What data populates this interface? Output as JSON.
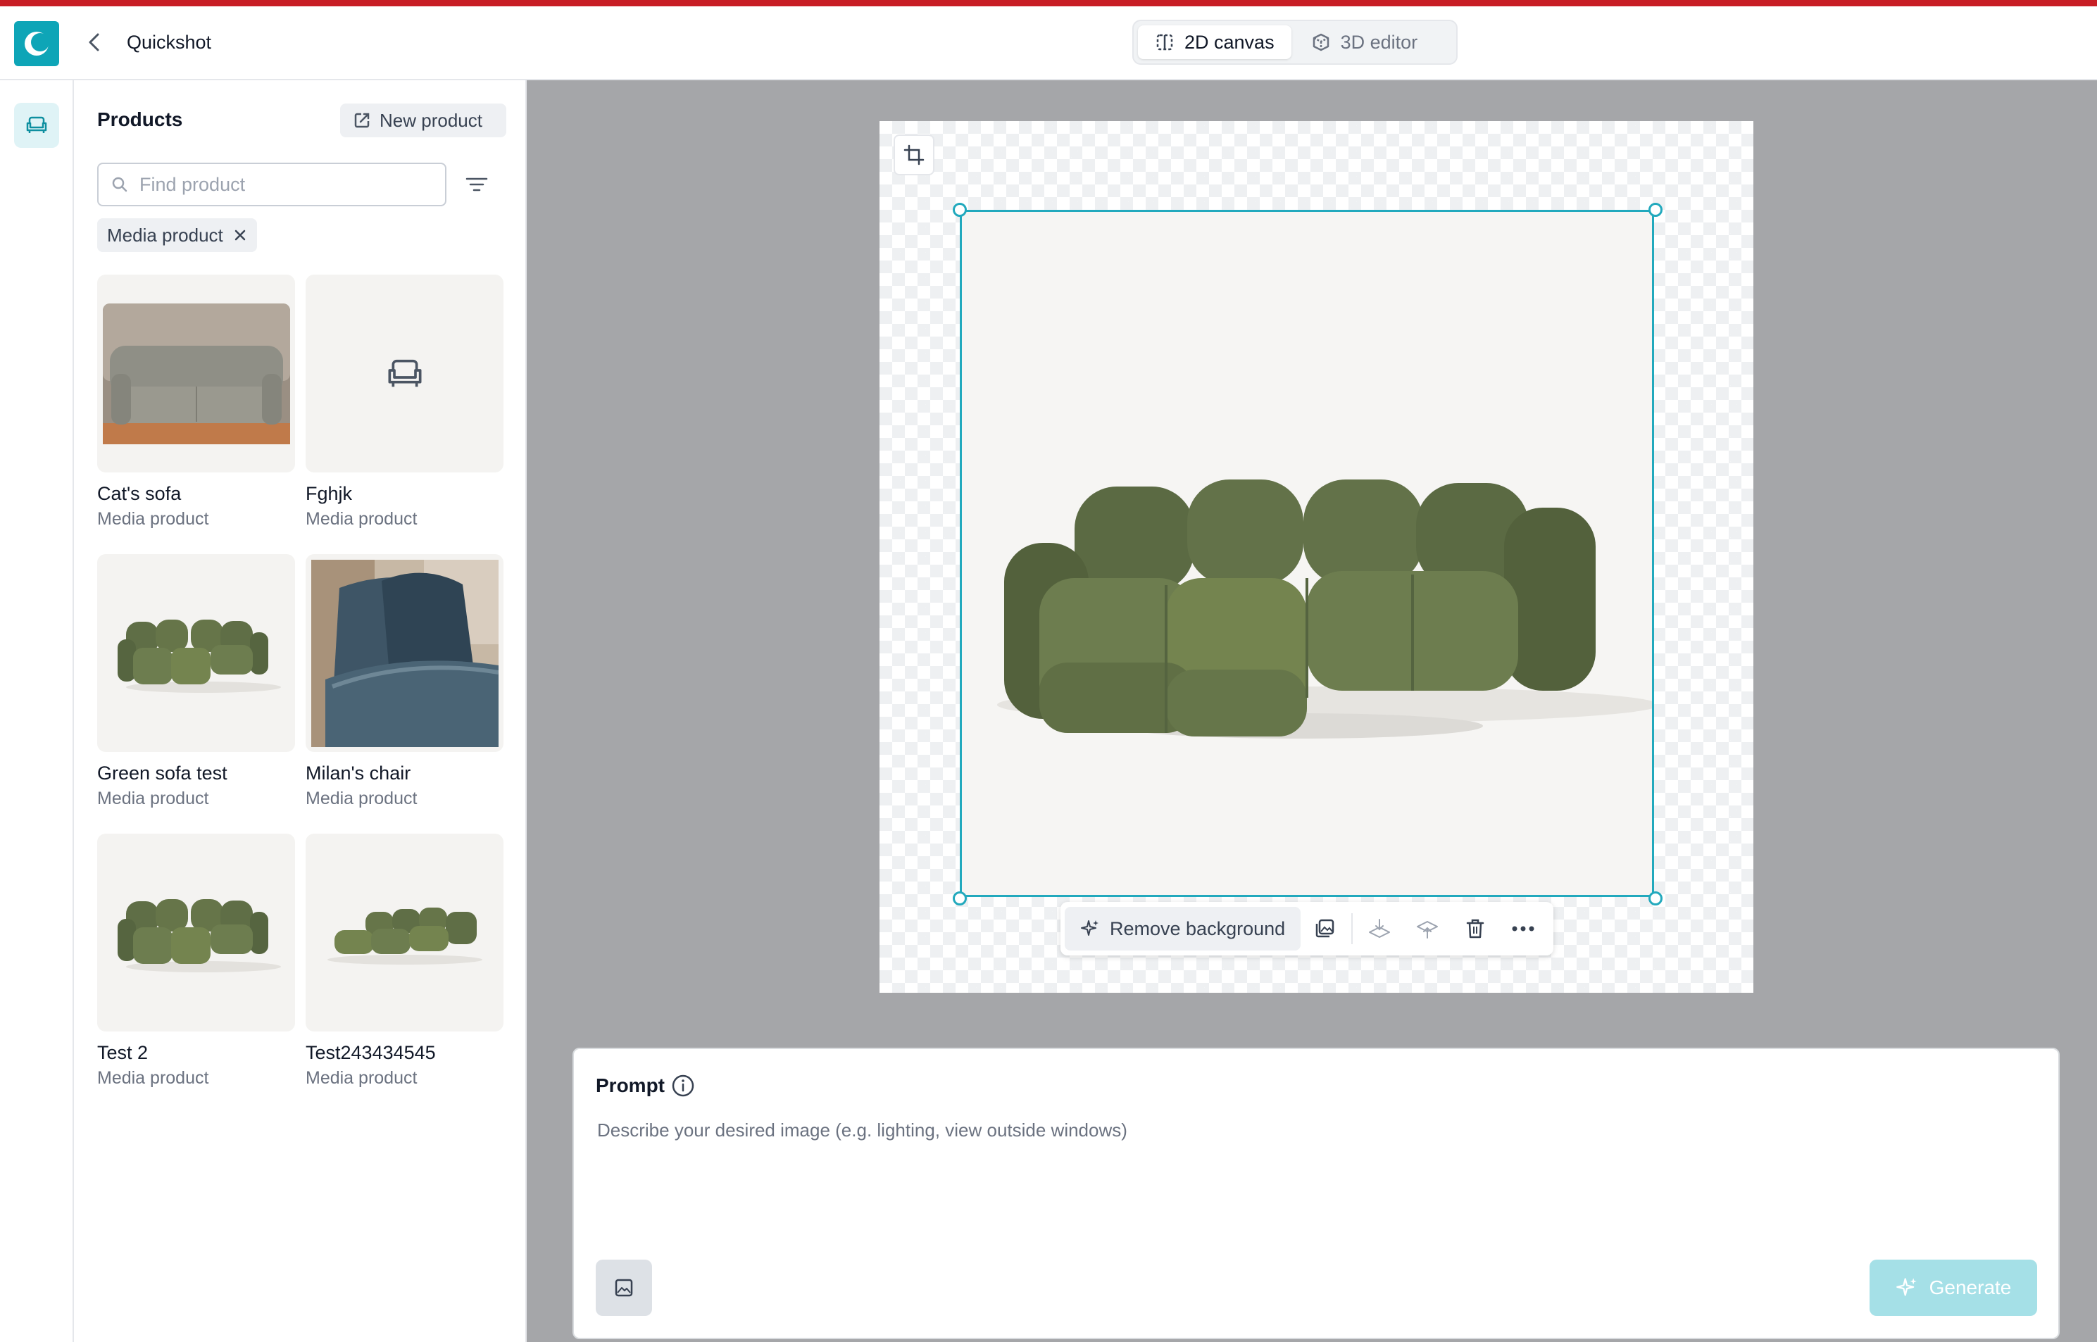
{
  "colors": {
    "accent": "#0ea5b7",
    "selection": "#22a9bd",
    "top_strip": "#c81e25",
    "canvas_bg": "#a5a6a9",
    "generate_disabled": "#a5e0e7"
  },
  "header": {
    "title": "Quickshot",
    "view_tabs": [
      {
        "label": "2D canvas",
        "icon": "panel-split-icon",
        "active": true
      },
      {
        "label": "3D editor",
        "icon": "cube-icon",
        "active": false
      }
    ]
  },
  "rail": {
    "items": [
      {
        "icon": "sofa-icon",
        "active": true
      }
    ]
  },
  "products": {
    "title": "Products",
    "new_product_label": "New product",
    "search_placeholder": "Find product",
    "filter_chip": "Media product",
    "items": [
      {
        "name": "Cat's sofa",
        "type": "Media product",
        "thumb": "beige-sofa-photo"
      },
      {
        "name": "Fghjk",
        "type": "Media product",
        "thumb": "sofa-placeholder-icon"
      },
      {
        "name": "Green sofa test",
        "type": "Media product",
        "thumb": "green-modular-sofa"
      },
      {
        "name": "Milan's chair",
        "type": "Media product",
        "thumb": "blue-chair-photo"
      },
      {
        "name": "Test 2",
        "type": "Media product",
        "thumb": "green-modular-sofa"
      },
      {
        "name": "Test243434545",
        "type": "Media product",
        "thumb": "green-sofa-angled"
      }
    ]
  },
  "canvas": {
    "toolbar": {
      "remove_background_label": "Remove background",
      "icons": [
        "layers-icon",
        "send-backward-icon",
        "bring-forward-icon",
        "trash-icon",
        "more-icon"
      ]
    }
  },
  "prompt": {
    "label": "Prompt",
    "placeholder": "Describe your desired image (e.g. lighting, view outside windows)",
    "value": "",
    "generate_label": "Generate"
  }
}
